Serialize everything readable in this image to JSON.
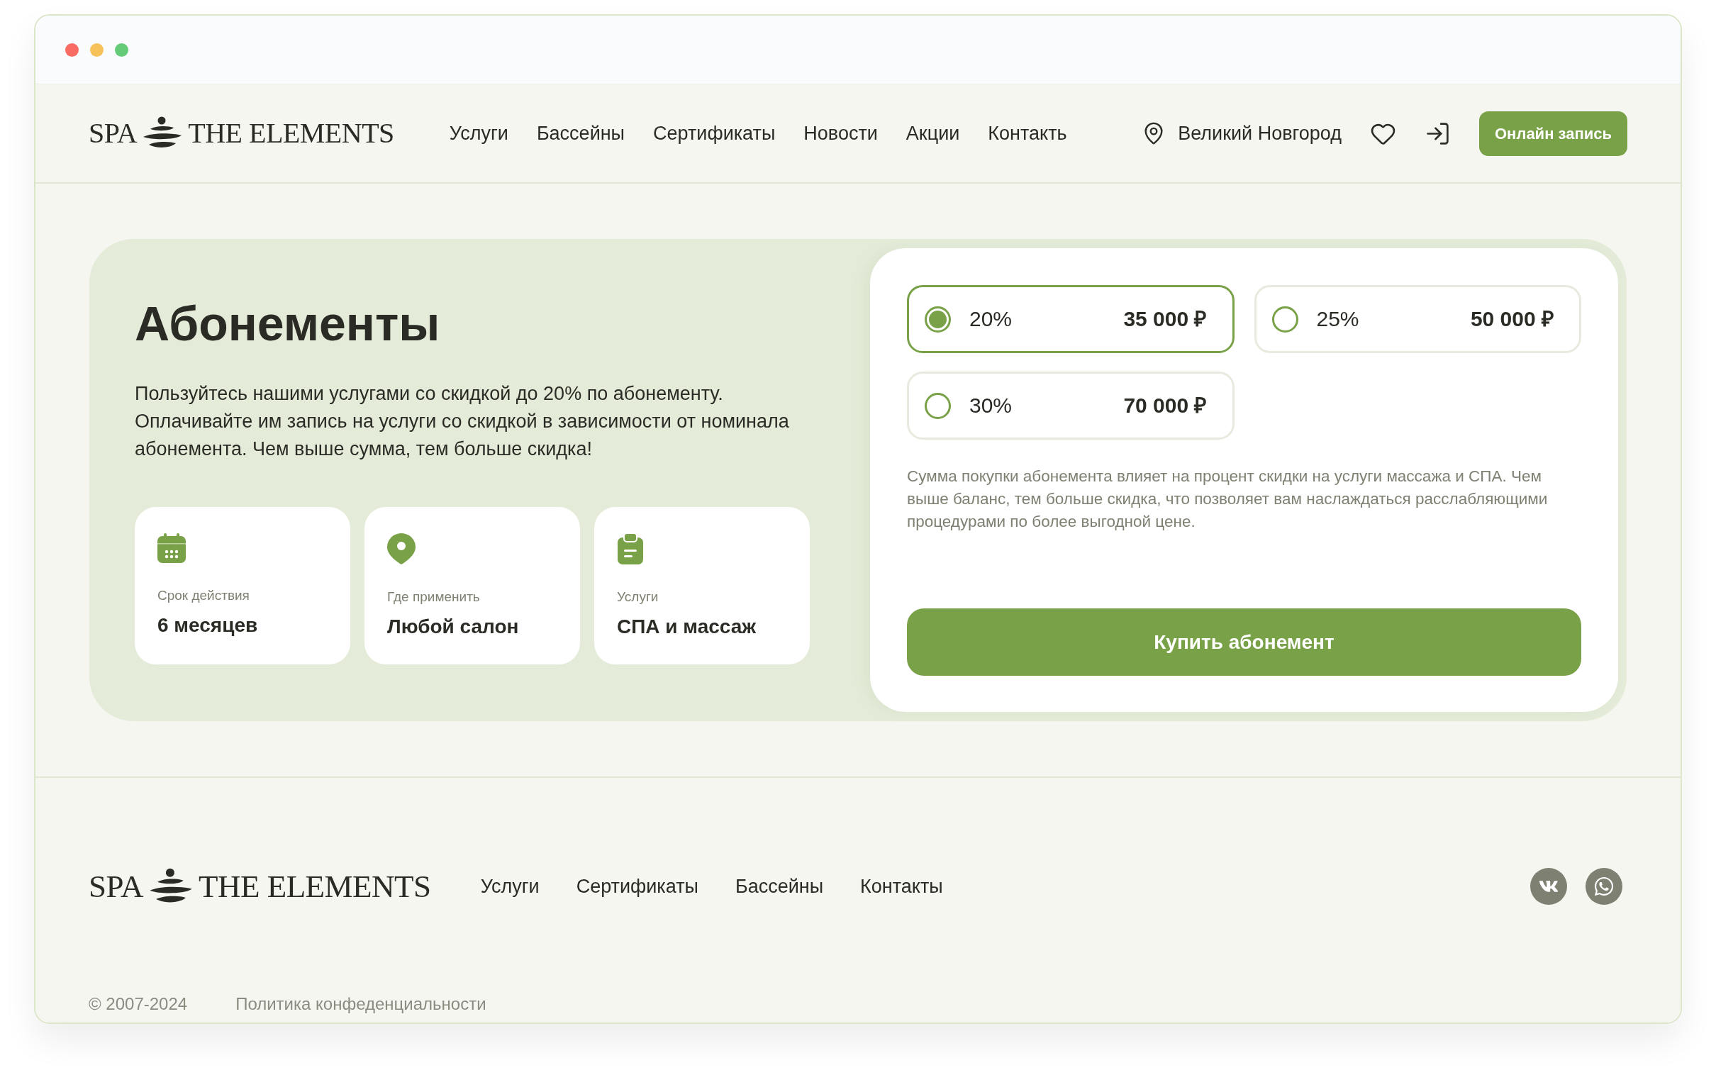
{
  "header": {
    "logo": {
      "left": "SPA",
      "right": "THE ELEMENTS"
    },
    "nav": [
      "Услуги",
      "Бассейны",
      "Сертификаты",
      "Новости",
      "Акции",
      "Контакть"
    ],
    "city": "Великий Новгород",
    "cta": "Онлайн запись"
  },
  "subscription": {
    "title": "Абонементы",
    "description": "Пользуйтесь нашими услугами со скидкой до 20% по абонементу. Оплачивайте им запись на услуги со скидкой в зависимости от номинала абонемента. Чем выше сумма, тем больше скидка!",
    "features": [
      {
        "label": "Срок действия",
        "value": "6 месяцев"
      },
      {
        "label": "Где применить",
        "value": "Любой салон"
      },
      {
        "label": "Услуги",
        "value": "СПА и массаж"
      }
    ],
    "options": [
      {
        "discount": "20%",
        "price": "35 000 ₽",
        "selected": true
      },
      {
        "discount": "25%",
        "price": "50 000 ₽",
        "selected": false
      },
      {
        "discount": "30%",
        "price": "70 000 ₽",
        "selected": false
      }
    ],
    "note": "Сумма покупки абонемента влияет на процент скидки на услуги массажа и СПА. Чем выше баланс, тем больше скидка, что позволяет вам наслаждаться расслабляющими процедурами по более выгодной цене.",
    "buy_button": "Купить абонемент"
  },
  "footer": {
    "logo": {
      "left": "SPA",
      "right": "THE ELEMENTS"
    },
    "nav": [
      "Услуги",
      "Сертификаты",
      "Бассейны",
      "Контакты"
    ],
    "copyright": "© 2007-2024",
    "privacy_link": "Политика конфеденциальности"
  }
}
